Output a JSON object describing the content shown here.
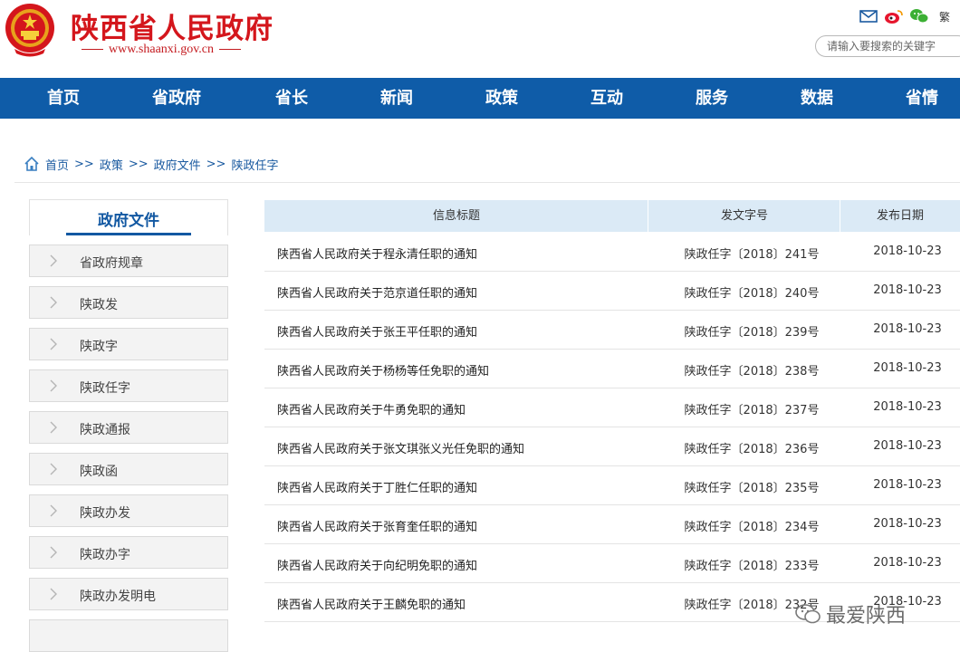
{
  "header": {
    "site_title": "陕西省人民政府",
    "site_url": "www.shaanxi.gov.cn",
    "traditional_label": "繁",
    "search_placeholder": "请输入要搜索的关键字",
    "brand_color": "#d4161c"
  },
  "nav": {
    "bg_color": "#0f5ca8",
    "items": [
      "首页",
      "省政府",
      "省长",
      "新闻",
      "政策",
      "互动",
      "服务",
      "数据",
      "省情"
    ]
  },
  "breadcrumb": {
    "items": [
      "首页",
      "政策",
      "政府文件",
      "陕政任字"
    ],
    "separator": ">>"
  },
  "sidebar": {
    "title": "政府文件",
    "items": [
      "省政府规章",
      "陕政发",
      "陕政字",
      "陕政任字",
      "陕政通报",
      "陕政函",
      "陕政办发",
      "陕政办字",
      "陕政办发明电"
    ]
  },
  "table": {
    "headers": [
      "信息标题",
      "发文字号",
      "发布日期"
    ],
    "rows": [
      {
        "title": "陕西省人民政府关于程永清任职的通知",
        "number": "陕政任字〔2018〕241号",
        "date": "2018-10-23"
      },
      {
        "title": "陕西省人民政府关于范京道任职的通知",
        "number": "陕政任字〔2018〕240号",
        "date": "2018-10-23"
      },
      {
        "title": "陕西省人民政府关于张王平任职的通知",
        "number": "陕政任字〔2018〕239号",
        "date": "2018-10-23"
      },
      {
        "title": "陕西省人民政府关于杨杨等任免职的通知",
        "number": "陕政任字〔2018〕238号",
        "date": "2018-10-23"
      },
      {
        "title": "陕西省人民政府关于牛勇免职的通知",
        "number": "陕政任字〔2018〕237号",
        "date": "2018-10-23"
      },
      {
        "title": "陕西省人民政府关于张文琪张义光任免职的通知",
        "number": "陕政任字〔2018〕236号",
        "date": "2018-10-23"
      },
      {
        "title": "陕西省人民政府关于丁胜仁任职的通知",
        "number": "陕政任字〔2018〕235号",
        "date": "2018-10-23"
      },
      {
        "title": "陕西省人民政府关于张育奎任职的通知",
        "number": "陕政任字〔2018〕234号",
        "date": "2018-10-23"
      },
      {
        "title": "陕西省人民政府关于向纪明免职的通知",
        "number": "陕政任字〔2018〕233号",
        "date": "2018-10-23"
      },
      {
        "title": "陕西省人民政府关于王麟免职的通知",
        "number": "陕政任字〔2018〕232号",
        "date": "2018-10-23"
      }
    ]
  },
  "watermark": {
    "text": "最爱陕西"
  }
}
